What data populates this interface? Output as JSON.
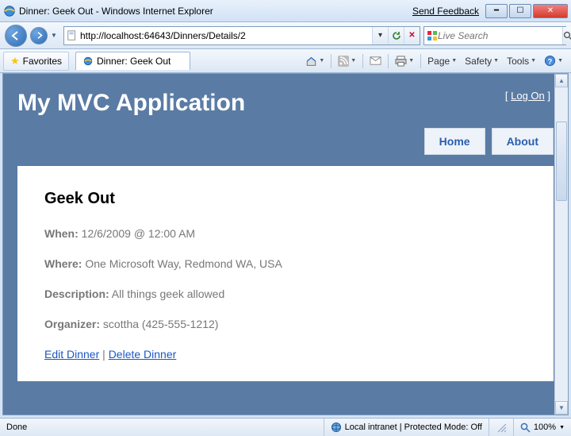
{
  "window": {
    "title": "Dinner: Geek Out - Windows Internet Explorer",
    "feedback": "Send Feedback"
  },
  "nav": {
    "url": "http://localhost:64643/Dinners/Details/2",
    "search_placeholder": "Live Search"
  },
  "favorites": {
    "label": "Favorites"
  },
  "tab": {
    "label": "Dinner: Geek Out"
  },
  "commands": {
    "page": "Page",
    "safety": "Safety",
    "tools": "Tools"
  },
  "site": {
    "logon_prefix": "[ ",
    "logon": "Log On",
    "logon_suffix": " ]",
    "title": "My MVC Application",
    "menu": {
      "home": "Home",
      "about": "About"
    }
  },
  "dinner": {
    "heading": "Geek Out",
    "when_label": "When:",
    "when_value": " 12/6/2009 @ 12:00 AM",
    "where_label": "Where:",
    "where_value": " One Microsoft Way, Redmond WA, USA",
    "desc_label": "Description:",
    "desc_value": " All things geek allowed",
    "org_label": "Organizer:",
    "org_value": " scottha (425-555-1212)",
    "edit": "Edit Dinner",
    "sep": " | ",
    "delete": "Delete Dinner"
  },
  "status": {
    "left": "Done",
    "zone": "Local intranet | Protected Mode: Off",
    "zoom": "100%"
  }
}
